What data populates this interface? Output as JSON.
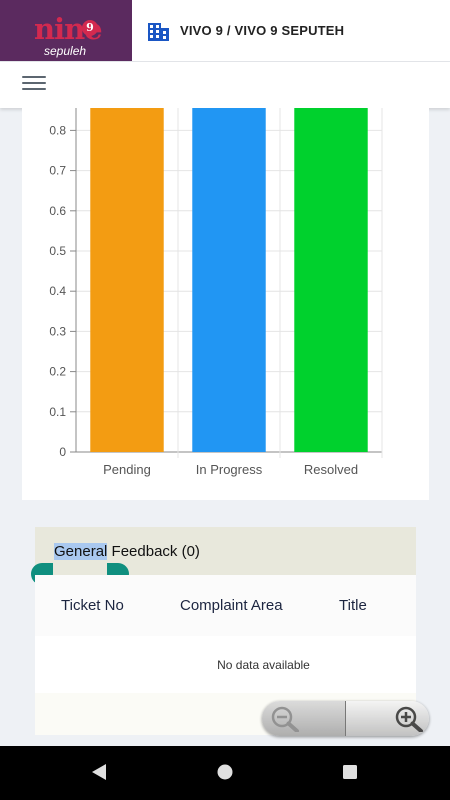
{
  "header": {
    "logo_text": "nine",
    "logo_badge": "9",
    "logo_sub": "sepuleh",
    "site_icon": "building-icon",
    "site_title": "VIVO 9 / VIVO 9 SEPUTEH"
  },
  "navbar": {
    "menu_icon": "hamburger-menu-icon"
  },
  "chart_data": {
    "type": "bar",
    "categories": [
      "Pending",
      "In Progress",
      "Resolved"
    ],
    "values": [
      1,
      1,
      1
    ],
    "colors": [
      "#f39c12",
      "#2196f3",
      "#00d12d"
    ],
    "yticks": [
      "0",
      "0.1",
      "0.2",
      "0.3",
      "0.4",
      "0.5",
      "0.6",
      "0.7",
      "0.8"
    ],
    "ylim": [
      0,
      1
    ],
    "grid": true,
    "title": "",
    "xlabel": "",
    "ylabel": ""
  },
  "feedback": {
    "title_selected": "General",
    "title_rest": " Feedback (0)",
    "columns": [
      "Ticket No",
      "Complaint Area",
      "Title"
    ],
    "empty_text": "No data available"
  },
  "zoom": {
    "zoom_out_icon": "zoom-out-icon",
    "zoom_in_icon": "zoom-in-icon"
  },
  "system_nav": {
    "back_icon": "back-icon",
    "home_icon": "home-icon",
    "recents_icon": "recents-icon"
  }
}
